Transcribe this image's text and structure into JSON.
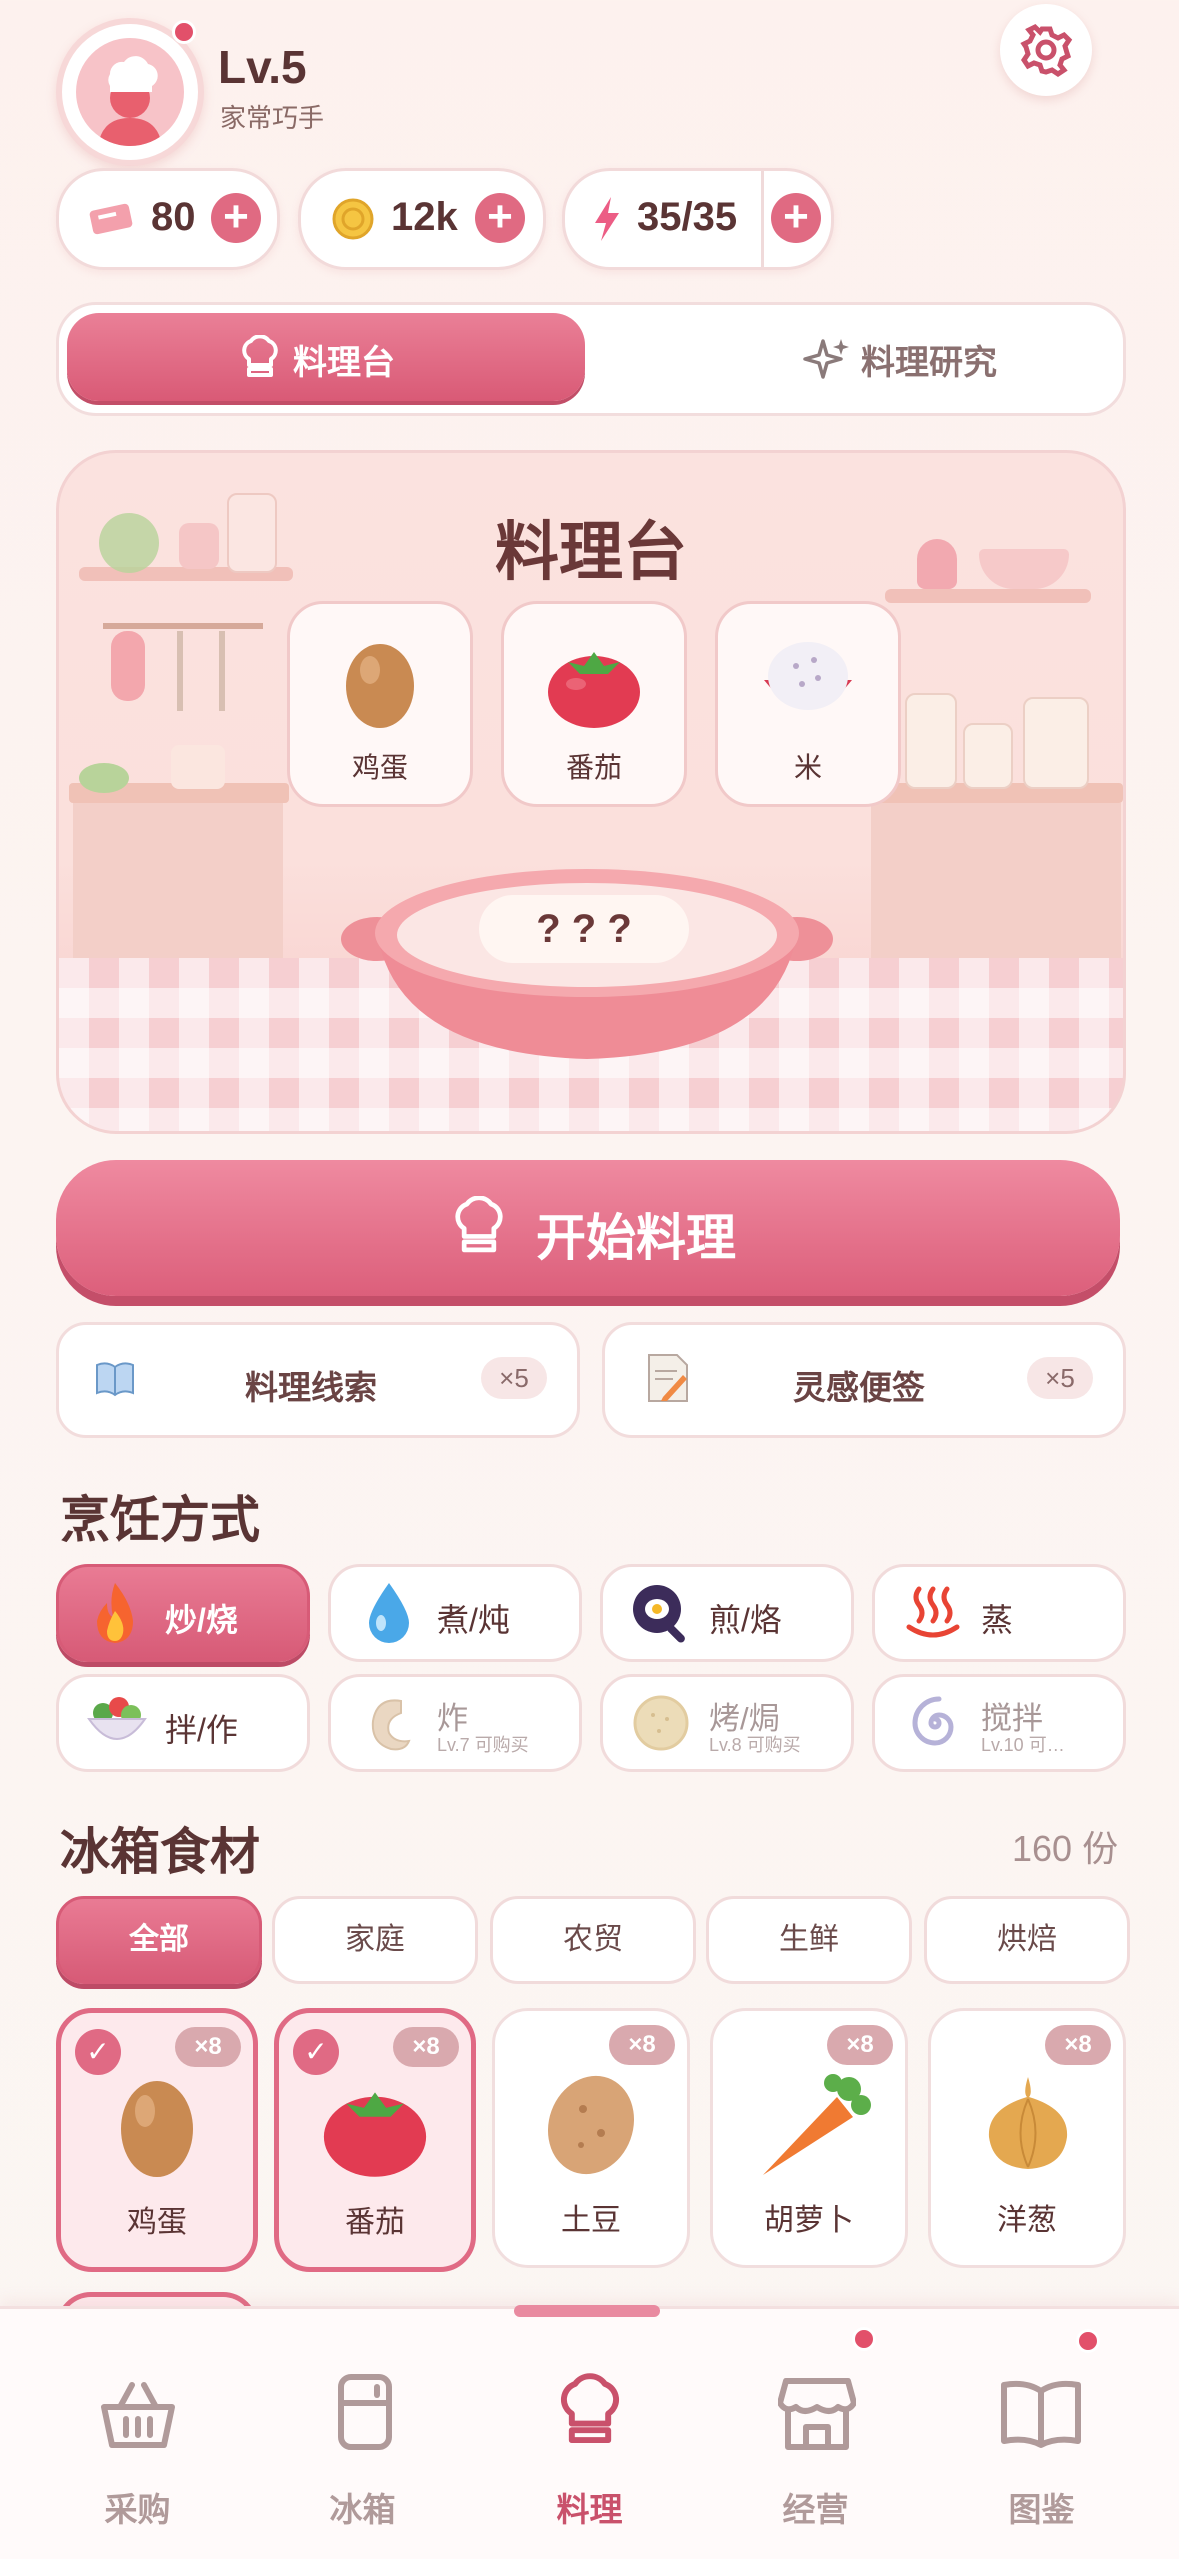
{
  "header": {
    "level": "Lv.5",
    "title": "家常巧手"
  },
  "resources": [
    {
      "name": "ticket",
      "value": "80"
    },
    {
      "name": "coin",
      "value": "12k"
    },
    {
      "name": "energy",
      "value": "35/35"
    }
  ],
  "tabs": [
    {
      "label": "料理台",
      "active": true
    },
    {
      "label": "料理研究",
      "active": false
    }
  ],
  "stage": {
    "title": "料理台",
    "ingredients": [
      "鸡蛋",
      "番茄",
      "米"
    ],
    "pot_text": "? ? ?"
  },
  "start_button": "开始料理",
  "tools": [
    {
      "label": "料理线索",
      "count": "×5"
    },
    {
      "label": "灵感便签",
      "count": "×5"
    }
  ],
  "cooking": {
    "title": "烹饪方式",
    "methods": [
      {
        "label": "炒/烧",
        "active": true
      },
      {
        "label": "煮/炖"
      },
      {
        "label": "煎/烙"
      },
      {
        "label": "蒸"
      },
      {
        "label": "拌/作"
      },
      {
        "label": "炸",
        "note": "Lv.7 可购买"
      },
      {
        "label": "烤/焗",
        "note": "Lv.8 可购买"
      },
      {
        "label": "搅拌",
        "note": "Lv.10 可…"
      }
    ]
  },
  "fridge": {
    "title": "冰箱食材",
    "count": "160 份",
    "categories": [
      "全部",
      "家庭",
      "农贸",
      "生鲜",
      "烘焙"
    ],
    "items": [
      {
        "name": "鸡蛋",
        "count": "×8",
        "selected": true
      },
      {
        "name": "番茄",
        "count": "×8",
        "selected": true
      },
      {
        "name": "土豆",
        "count": "×8"
      },
      {
        "name": "胡萝卜",
        "count": "×8"
      },
      {
        "name": "洋葱",
        "count": "×8"
      }
    ]
  },
  "nav": [
    {
      "label": "采购"
    },
    {
      "label": "冰箱"
    },
    {
      "label": "料理",
      "active": true
    },
    {
      "label": "经营",
      "badge": true
    },
    {
      "label": "图鉴",
      "badge": true
    }
  ],
  "colors": {
    "accent": "#d95a76",
    "background": "#fbf3f0",
    "text": "#5a3434"
  }
}
